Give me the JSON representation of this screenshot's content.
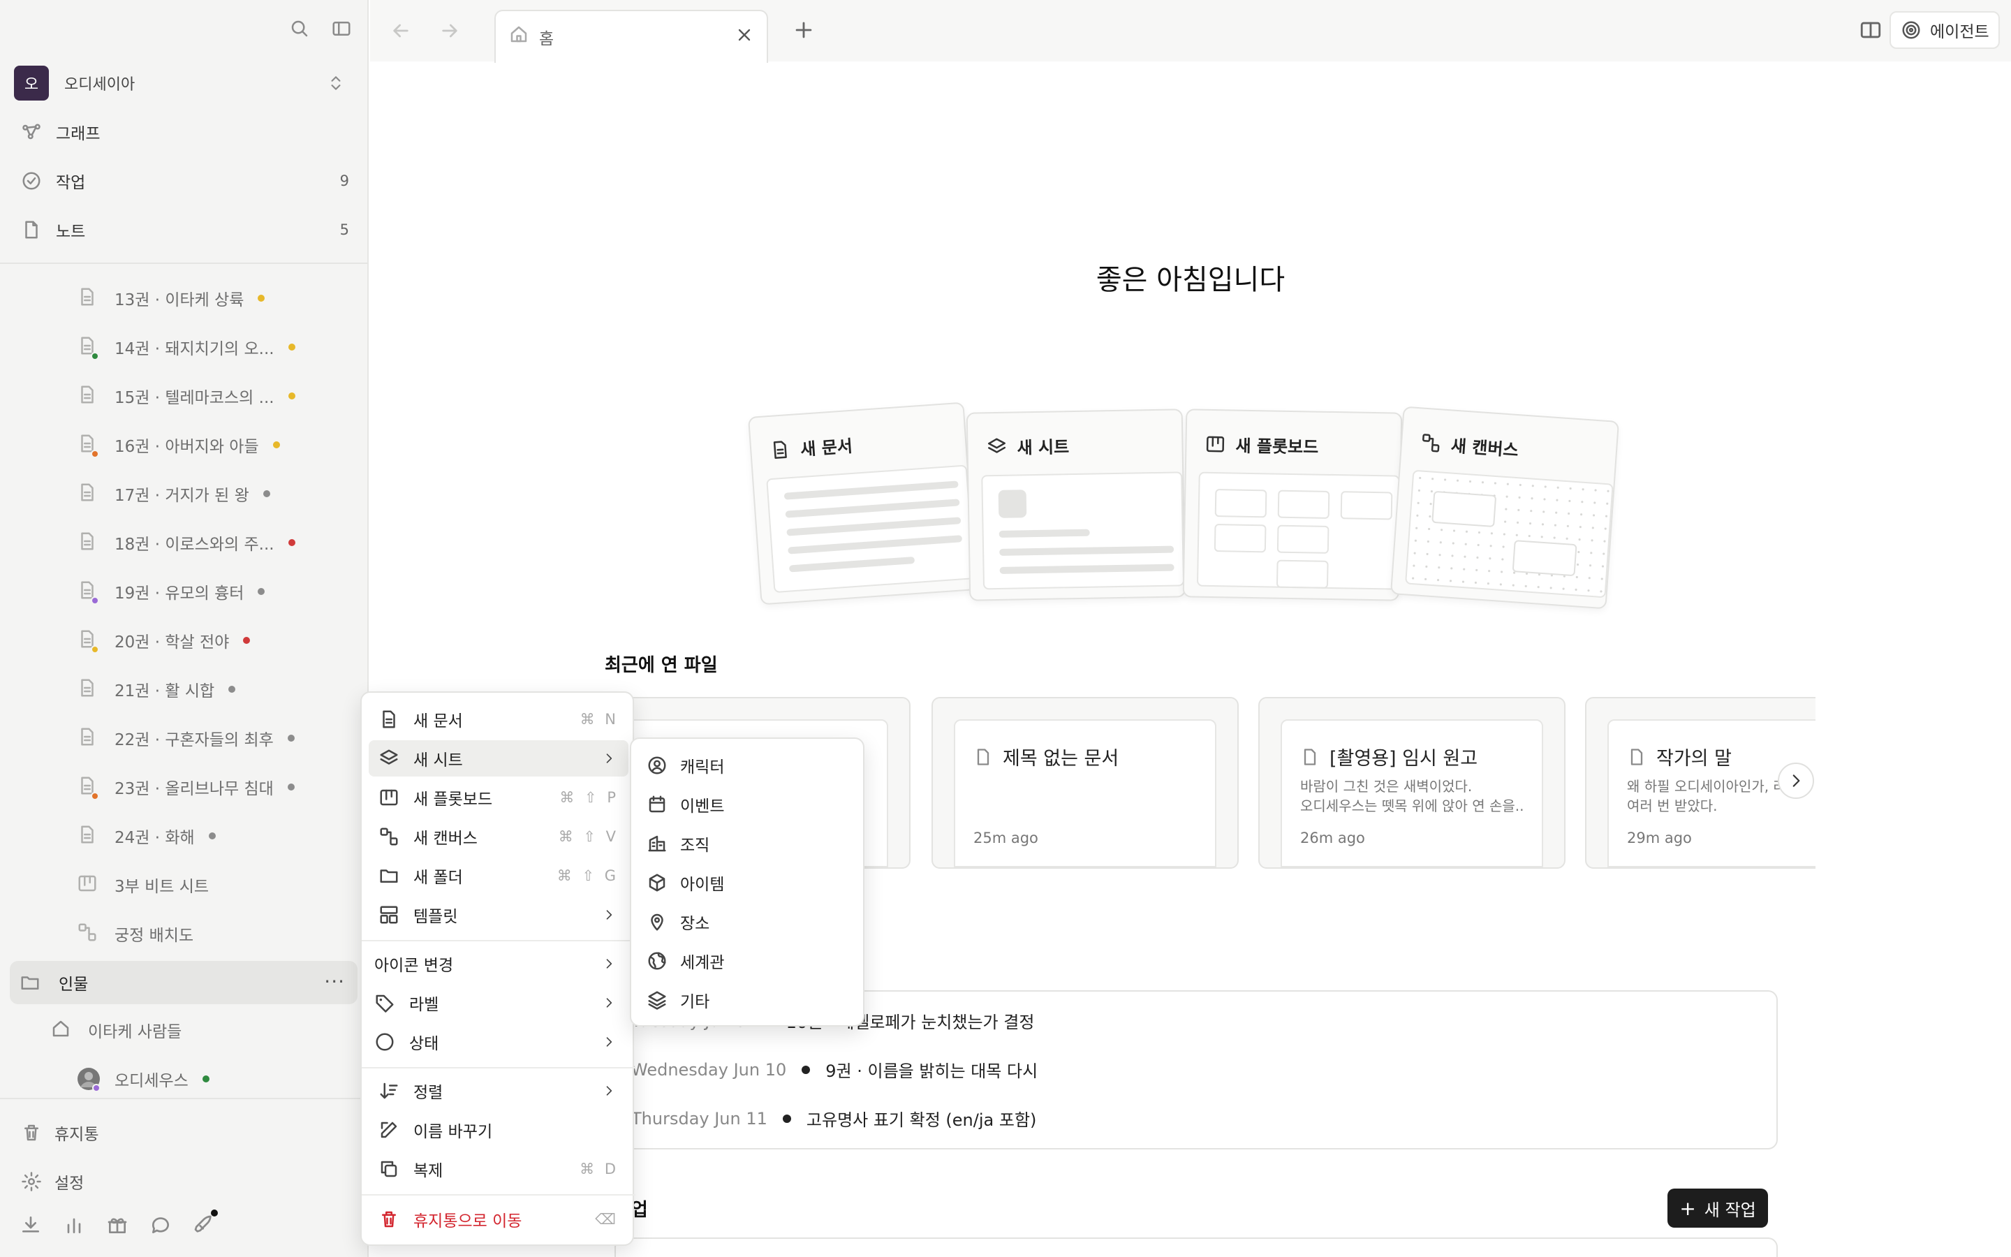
{
  "sidebar": {
    "workspace": {
      "avatar": "오",
      "name": "오디세이아"
    },
    "nav": [
      {
        "label": "그래프",
        "icon": "graph-icon",
        "count": ""
      },
      {
        "label": "작업",
        "icon": "check-circle-icon",
        "count": "9"
      },
      {
        "label": "노트",
        "icon": "note-icon",
        "count": "5"
      }
    ],
    "tree": [
      {
        "label": "13권 · 이타케 상륙",
        "dot": "#e7b82a",
        "sub": ""
      },
      {
        "label": "14권 · 돼지치기의 오...",
        "dot": "#e7b82a",
        "sub": "#2f8a3f"
      },
      {
        "label": "15권 · 텔레마코스의 ...",
        "dot": "#e7b82a",
        "sub": ""
      },
      {
        "label": "16권 · 아버지와 아들",
        "dot": "#e7b82a",
        "sub": "#e2742b"
      },
      {
        "label": "17권 · 거지가 된 왕",
        "dot": "#8c8c8c",
        "sub": ""
      },
      {
        "label": "18권 · 이로스와의 주...",
        "dot": "#d03a3a",
        "sub": ""
      },
      {
        "label": "19권 · 유모의 흉터",
        "dot": "#8c8c8c",
        "sub": "#9a6ad6"
      },
      {
        "label": "20권 · 학살 전야",
        "dot": "#d03a3a",
        "sub": "#e7b82a"
      },
      {
        "label": "21권 · 활 시합",
        "dot": "#8c8c8c",
        "sub": ""
      },
      {
        "label": "22권 · 구혼자들의 최후",
        "dot": "#8c8c8c",
        "sub": ""
      },
      {
        "label": "23권 · 올리브나무 침대",
        "dot": "#8c8c8c",
        "sub": "#e2742b"
      },
      {
        "label": "24권 · 화해",
        "dot": "#8c8c8c",
        "sub": ""
      },
      {
        "label": "3부 비트 시트",
        "dot": "",
        "sub": ""
      },
      {
        "label": "궁정 배치도",
        "dot": "",
        "sub": ""
      }
    ],
    "folder": {
      "label": "인물",
      "more": "···"
    },
    "folder_children": [
      {
        "label": "이타케 사람들"
      },
      {
        "label": "오디세우스",
        "dot": "#2f8a3f"
      }
    ],
    "bottom": [
      {
        "label": "휴지통",
        "icon": "trash-icon"
      },
      {
        "label": "설정",
        "icon": "gear-icon"
      }
    ]
  },
  "topbar": {
    "tab_label": "홈",
    "agent_label": "에이전트"
  },
  "main": {
    "greeting": "좋은 아침입니다",
    "create_cards": [
      {
        "label": "새 문서",
        "icon": "document-icon"
      },
      {
        "label": "새 시트",
        "icon": "layers-icon"
      },
      {
        "label": "새 플롯보드",
        "icon": "board-icon"
      },
      {
        "label": "새 캔버스",
        "icon": "canvas-icon"
      }
    ],
    "recent_title": "최근에 연 파일",
    "recent": [
      {
        "title": "",
        "preview1": "",
        "preview2": "",
        "time": ""
      },
      {
        "title": "제목 없는 문서",
        "preview1": "",
        "preview2": "",
        "time": "25m ago"
      },
      {
        "title": "[촬영용] 임시 원고",
        "preview1": "바람이 그친 것은 새벽이었다.",
        "preview2": "오디세우스는 뗏목 위에 앉아 연 손을...",
        "time": "26m ago"
      },
      {
        "title": "작가의 말",
        "preview1": "왜 하필 오디세이아인가, 라",
        "preview2": "여러 번 받았다.",
        "time": "29m ago"
      }
    ],
    "timeline": [
      {
        "date": "Tuesday Jun 9",
        "text": "10권 · 페넬로페가 눈치챘는가 결정"
      },
      {
        "date": "Wednesday Jun 10",
        "text": "9권 · 이름을 밝히는 대목 다시"
      },
      {
        "date": "Thursday Jun 11",
        "text": "고유명사 표기 확정 (en/ja 포함)"
      }
    ],
    "tasks_title": "작업",
    "new_task_label": "새 작업",
    "new_task_plus": "+"
  },
  "context_menu": {
    "items": [
      {
        "label": "새 문서",
        "icon": "document-icon",
        "shortcut": "⌘ N"
      },
      {
        "label": "새 시트",
        "icon": "layers-icon",
        "shortcut": "",
        "submenu": true
      },
      {
        "label": "새 플롯보드",
        "icon": "board-icon",
        "shortcut": "⌘ ⇧ P"
      },
      {
        "label": "새 캔버스",
        "icon": "canvas-icon",
        "shortcut": "⌘ ⇧ V"
      },
      {
        "label": "새 폴더",
        "icon": "folder-icon",
        "shortcut": "⌘ ⇧ G"
      },
      {
        "label": "템플릿",
        "icon": "template-icon",
        "shortcut": "",
        "submenu": true
      },
      {
        "label": "아이콘 변경",
        "icon": "",
        "shortcut": "",
        "submenu": true
      },
      {
        "label": "라벨",
        "icon": "tag-icon",
        "shortcut": "",
        "submenu": true
      },
      {
        "label": "상태",
        "icon": "circle-icon",
        "shortcut": "",
        "submenu": true
      },
      {
        "label": "정렬",
        "icon": "sort-icon",
        "shortcut": "",
        "submenu": true
      },
      {
        "label": "이름 바꾸기",
        "icon": "edit-icon",
        "shortcut": ""
      },
      {
        "label": "복제",
        "icon": "copy-icon",
        "shortcut": "⌘ D"
      },
      {
        "label": "휴지통으로 이동",
        "icon": "trash-icon",
        "shortcut": "⌫"
      }
    ]
  },
  "sheet_submenu": {
    "items": [
      {
        "label": "캐릭터",
        "icon": "person-icon"
      },
      {
        "label": "이벤트",
        "icon": "calendar-icon"
      },
      {
        "label": "조직",
        "icon": "building-icon"
      },
      {
        "label": "아이템",
        "icon": "cube-icon"
      },
      {
        "label": "장소",
        "icon": "location-icon"
      },
      {
        "label": "세계관",
        "icon": "globe-icon"
      },
      {
        "label": "기타",
        "icon": "layers-icon"
      }
    ]
  }
}
